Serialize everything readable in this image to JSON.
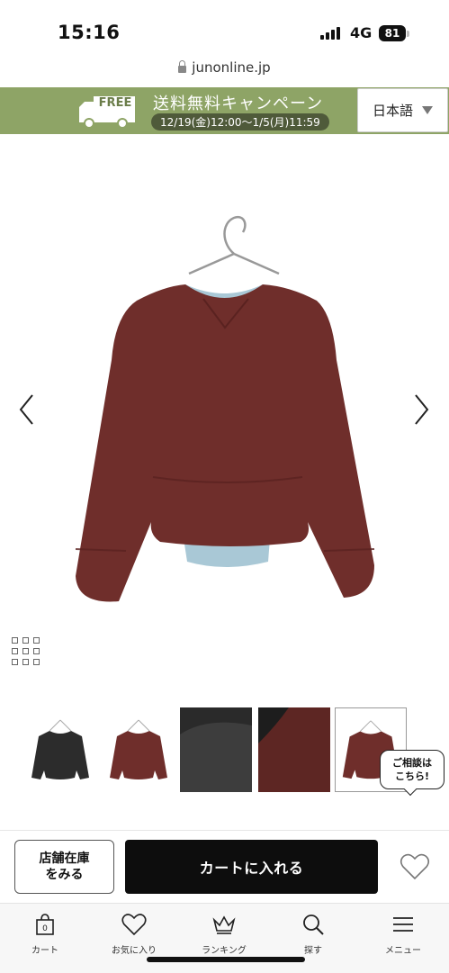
{
  "status_bar": {
    "time": "15:16",
    "network": "4G",
    "battery": "81"
  },
  "browser": {
    "url": "junonline.jp"
  },
  "banner": {
    "free_label": "FREE",
    "title": "送料無料キャンペーン",
    "dates": "12/19(金)12:00〜1/5(月)11:59",
    "language": "日本語",
    "bg_color": "#8ea466"
  },
  "product": {
    "main_image": "maroon-sweater-on-hanger",
    "thumbnails": [
      "charcoal-sweater",
      "maroon-sweater",
      "charcoal-fabric-closeup",
      "maroon-fabric-closeup",
      "maroon-sweater-selected"
    ],
    "consult_text": "ご相談は\nこちら!"
  },
  "actions": {
    "store_stock": "店舗在庫\nをみる",
    "add_to_cart": "カートに入れる"
  },
  "bottom_nav": {
    "items": [
      {
        "label": "カート",
        "icon": "bag-icon",
        "badge": "0"
      },
      {
        "label": "お気に入り",
        "icon": "heart-icon"
      },
      {
        "label": "ランキング",
        "icon": "crown-icon"
      },
      {
        "label": "探す",
        "icon": "search-icon"
      },
      {
        "label": "メニュー",
        "icon": "menu-icon"
      }
    ]
  }
}
